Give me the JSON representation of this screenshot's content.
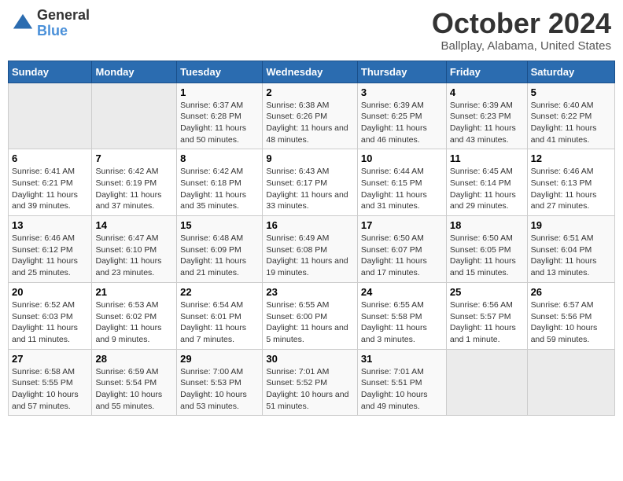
{
  "header": {
    "logo_line1": "General",
    "logo_line2": "Blue",
    "month": "October 2024",
    "location": "Ballplay, Alabama, United States"
  },
  "days_of_week": [
    "Sunday",
    "Monday",
    "Tuesday",
    "Wednesday",
    "Thursday",
    "Friday",
    "Saturday"
  ],
  "weeks": [
    [
      {
        "day": "",
        "sunrise": "",
        "sunset": "",
        "daylight": "",
        "empty": true
      },
      {
        "day": "",
        "sunrise": "",
        "sunset": "",
        "daylight": "",
        "empty": true
      },
      {
        "day": "1",
        "sunrise": "Sunrise: 6:37 AM",
        "sunset": "Sunset: 6:28 PM",
        "daylight": "Daylight: 11 hours and 50 minutes."
      },
      {
        "day": "2",
        "sunrise": "Sunrise: 6:38 AM",
        "sunset": "Sunset: 6:26 PM",
        "daylight": "Daylight: 11 hours and 48 minutes."
      },
      {
        "day": "3",
        "sunrise": "Sunrise: 6:39 AM",
        "sunset": "Sunset: 6:25 PM",
        "daylight": "Daylight: 11 hours and 46 minutes."
      },
      {
        "day": "4",
        "sunrise": "Sunrise: 6:39 AM",
        "sunset": "Sunset: 6:23 PM",
        "daylight": "Daylight: 11 hours and 43 minutes."
      },
      {
        "day": "5",
        "sunrise": "Sunrise: 6:40 AM",
        "sunset": "Sunset: 6:22 PM",
        "daylight": "Daylight: 11 hours and 41 minutes."
      }
    ],
    [
      {
        "day": "6",
        "sunrise": "Sunrise: 6:41 AM",
        "sunset": "Sunset: 6:21 PM",
        "daylight": "Daylight: 11 hours and 39 minutes."
      },
      {
        "day": "7",
        "sunrise": "Sunrise: 6:42 AM",
        "sunset": "Sunset: 6:19 PM",
        "daylight": "Daylight: 11 hours and 37 minutes."
      },
      {
        "day": "8",
        "sunrise": "Sunrise: 6:42 AM",
        "sunset": "Sunset: 6:18 PM",
        "daylight": "Daylight: 11 hours and 35 minutes."
      },
      {
        "day": "9",
        "sunrise": "Sunrise: 6:43 AM",
        "sunset": "Sunset: 6:17 PM",
        "daylight": "Daylight: 11 hours and 33 minutes."
      },
      {
        "day": "10",
        "sunrise": "Sunrise: 6:44 AM",
        "sunset": "Sunset: 6:15 PM",
        "daylight": "Daylight: 11 hours and 31 minutes."
      },
      {
        "day": "11",
        "sunrise": "Sunrise: 6:45 AM",
        "sunset": "Sunset: 6:14 PM",
        "daylight": "Daylight: 11 hours and 29 minutes."
      },
      {
        "day": "12",
        "sunrise": "Sunrise: 6:46 AM",
        "sunset": "Sunset: 6:13 PM",
        "daylight": "Daylight: 11 hours and 27 minutes."
      }
    ],
    [
      {
        "day": "13",
        "sunrise": "Sunrise: 6:46 AM",
        "sunset": "Sunset: 6:12 PM",
        "daylight": "Daylight: 11 hours and 25 minutes."
      },
      {
        "day": "14",
        "sunrise": "Sunrise: 6:47 AM",
        "sunset": "Sunset: 6:10 PM",
        "daylight": "Daylight: 11 hours and 23 minutes."
      },
      {
        "day": "15",
        "sunrise": "Sunrise: 6:48 AM",
        "sunset": "Sunset: 6:09 PM",
        "daylight": "Daylight: 11 hours and 21 minutes."
      },
      {
        "day": "16",
        "sunrise": "Sunrise: 6:49 AM",
        "sunset": "Sunset: 6:08 PM",
        "daylight": "Daylight: 11 hours and 19 minutes."
      },
      {
        "day": "17",
        "sunrise": "Sunrise: 6:50 AM",
        "sunset": "Sunset: 6:07 PM",
        "daylight": "Daylight: 11 hours and 17 minutes."
      },
      {
        "day": "18",
        "sunrise": "Sunrise: 6:50 AM",
        "sunset": "Sunset: 6:05 PM",
        "daylight": "Daylight: 11 hours and 15 minutes."
      },
      {
        "day": "19",
        "sunrise": "Sunrise: 6:51 AM",
        "sunset": "Sunset: 6:04 PM",
        "daylight": "Daylight: 11 hours and 13 minutes."
      }
    ],
    [
      {
        "day": "20",
        "sunrise": "Sunrise: 6:52 AM",
        "sunset": "Sunset: 6:03 PM",
        "daylight": "Daylight: 11 hours and 11 minutes."
      },
      {
        "day": "21",
        "sunrise": "Sunrise: 6:53 AM",
        "sunset": "Sunset: 6:02 PM",
        "daylight": "Daylight: 11 hours and 9 minutes."
      },
      {
        "day": "22",
        "sunrise": "Sunrise: 6:54 AM",
        "sunset": "Sunset: 6:01 PM",
        "daylight": "Daylight: 11 hours and 7 minutes."
      },
      {
        "day": "23",
        "sunrise": "Sunrise: 6:55 AM",
        "sunset": "Sunset: 6:00 PM",
        "daylight": "Daylight: 11 hours and 5 minutes."
      },
      {
        "day": "24",
        "sunrise": "Sunrise: 6:55 AM",
        "sunset": "Sunset: 5:58 PM",
        "daylight": "Daylight: 11 hours and 3 minutes."
      },
      {
        "day": "25",
        "sunrise": "Sunrise: 6:56 AM",
        "sunset": "Sunset: 5:57 PM",
        "daylight": "Daylight: 11 hours and 1 minute."
      },
      {
        "day": "26",
        "sunrise": "Sunrise: 6:57 AM",
        "sunset": "Sunset: 5:56 PM",
        "daylight": "Daylight: 10 hours and 59 minutes."
      }
    ],
    [
      {
        "day": "27",
        "sunrise": "Sunrise: 6:58 AM",
        "sunset": "Sunset: 5:55 PM",
        "daylight": "Daylight: 10 hours and 57 minutes."
      },
      {
        "day": "28",
        "sunrise": "Sunrise: 6:59 AM",
        "sunset": "Sunset: 5:54 PM",
        "daylight": "Daylight: 10 hours and 55 minutes."
      },
      {
        "day": "29",
        "sunrise": "Sunrise: 7:00 AM",
        "sunset": "Sunset: 5:53 PM",
        "daylight": "Daylight: 10 hours and 53 minutes."
      },
      {
        "day": "30",
        "sunrise": "Sunrise: 7:01 AM",
        "sunset": "Sunset: 5:52 PM",
        "daylight": "Daylight: 10 hours and 51 minutes."
      },
      {
        "day": "31",
        "sunrise": "Sunrise: 7:01 AM",
        "sunset": "Sunset: 5:51 PM",
        "daylight": "Daylight: 10 hours and 49 minutes."
      },
      {
        "day": "",
        "sunrise": "",
        "sunset": "",
        "daylight": "",
        "empty": true
      },
      {
        "day": "",
        "sunrise": "",
        "sunset": "",
        "daylight": "",
        "empty": true
      }
    ]
  ]
}
